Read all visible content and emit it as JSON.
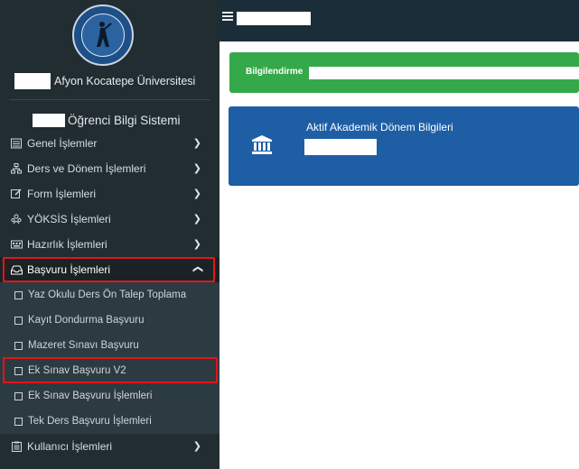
{
  "sidebar": {
    "university_name": "Afyon Kocatepe Üniversitesi",
    "system_name": "Öğrenci Bilgi Sistemi",
    "menu": [
      {
        "label": "Genel İşlemler",
        "icon": "list-icon"
      },
      {
        "label": "Ders ve Dönem İşlemleri",
        "icon": "sitemap-icon"
      },
      {
        "label": "Form İşlemleri",
        "icon": "edit-form-icon"
      },
      {
        "label": "YÖKSİS İşlemleri",
        "icon": "users-icon"
      },
      {
        "label": "Hazırlık İşlemleri",
        "icon": "keyboard-icon"
      },
      {
        "label": "Başvuru İşlemleri",
        "icon": "inbox-icon"
      }
    ],
    "submenu": [
      "Yaz Okulu Ders Ön Talep Toplama",
      "Kayıt Dondurma Başvuru",
      "Mazeret Sınavı Başvuru",
      "Ek Sınav Başvuru V2",
      "Ek Sınav Başvuru İşlemleri",
      "Tek Ders Başvuru İşlemleri"
    ],
    "user_menu": {
      "label": "Kullanıcı İşlemleri",
      "icon": "clipboard-icon"
    }
  },
  "main": {
    "notice_label": "Bilgilendirme",
    "card_title": "Aktif Akademik Dönem Bilgileri"
  },
  "colors": {
    "sidebar_bg": "#222d32",
    "topbar_bg": "#1c2d3a",
    "notice_green": "#35a84a",
    "card_blue": "#1e5ea5",
    "highlight_red": "#e3141b"
  }
}
